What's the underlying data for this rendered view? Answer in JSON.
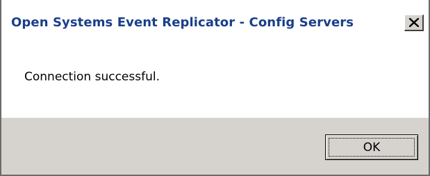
{
  "window": {
    "title": "Open Systems Event Replicator - Config Servers",
    "close_icon": "close-x-icon"
  },
  "message": {
    "text": "Connection successful."
  },
  "buttons": {
    "ok_label": "OK"
  },
  "colors": {
    "title_text": "#1a3f8a",
    "footer_bg": "#d6d3ce",
    "content_bg": "#ffffff"
  }
}
